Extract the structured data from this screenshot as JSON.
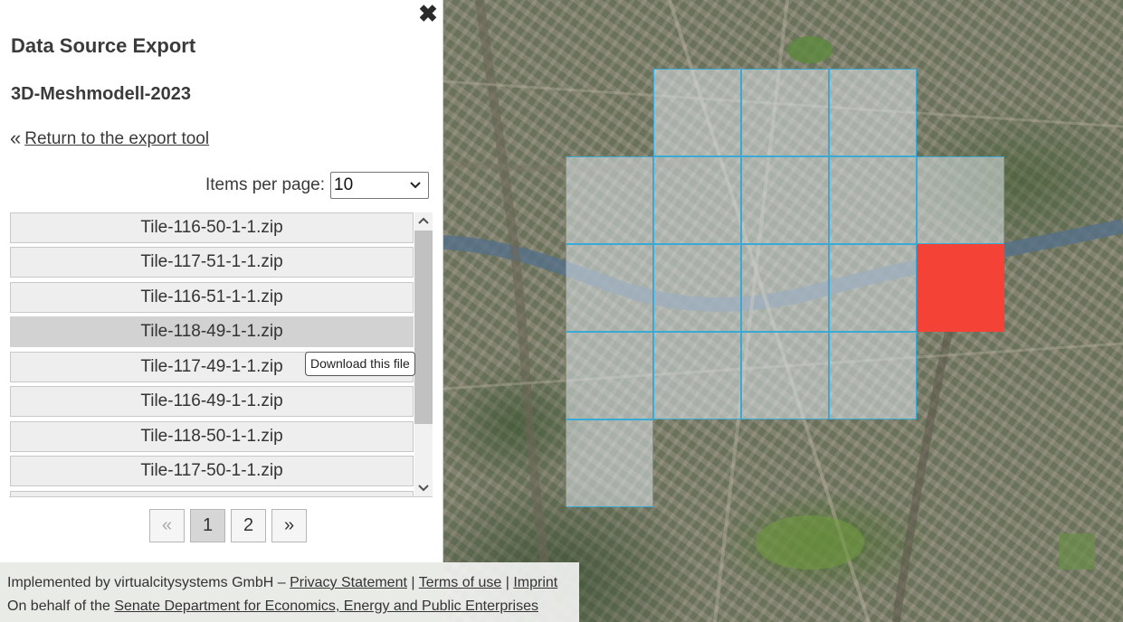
{
  "panel": {
    "close_icon": "✖",
    "title": "Data Source Export",
    "subtitle": "3D-Meshmodell-2023",
    "return_icon": "«",
    "return_label": "Return to the export tool",
    "items_per_page_label": "Items per page:",
    "items_per_page_value": "10",
    "files": [
      "Tile-116-50-1-1.zip",
      "Tile-117-51-1-1.zip",
      "Tile-116-51-1-1.zip",
      "Tile-118-49-1-1.zip",
      "Tile-117-49-1-1.zip",
      "Tile-116-49-1-1.zip",
      "Tile-118-50-1-1.zip",
      "Tile-117-50-1-1.zip"
    ],
    "tooltip": "Download this file",
    "pagination": {
      "prev": "«",
      "pages": [
        "1",
        "2"
      ],
      "next": "»",
      "current": "1"
    }
  },
  "footer": {
    "line1_prefix": "Implemented by virtualcitysystems GmbH – ",
    "privacy": "Privacy Statement",
    "sep1": " | ",
    "terms": "Terms of use",
    "sep2": " | ",
    "imprint": "Imprint",
    "line2_prefix": "On behalf of the ",
    "senate": "Senate Department for Economics, Energy and Public Enterprises"
  },
  "colors": {
    "selected_tile": "#f44336",
    "tile_border": "#3aa9d6"
  }
}
